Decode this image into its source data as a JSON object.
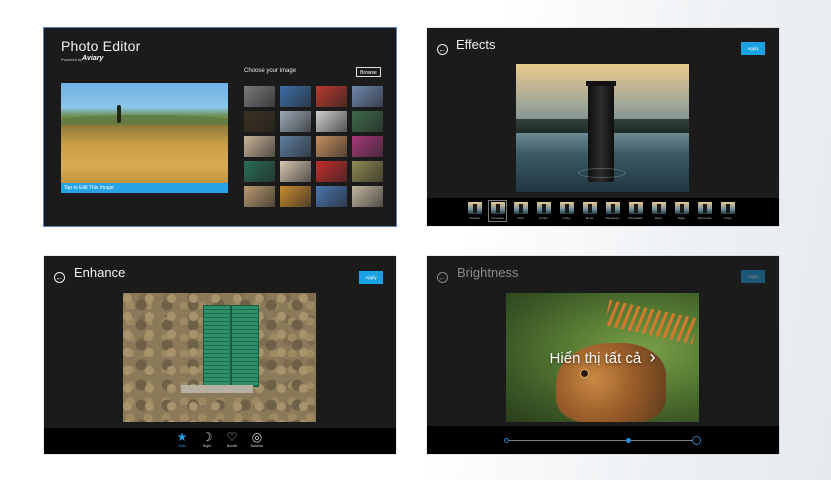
{
  "colors": {
    "accent": "#1aa1e4",
    "panel_bg": "#1b1b1b",
    "toolbar_bg": "#000000"
  },
  "photo_editor": {
    "title": "Photo Editor",
    "powered_by": "Powered by",
    "brand": "Aviary",
    "caption": "Tap to Edit This Image",
    "choose_label": "Choose your image",
    "browse_label": "Browse",
    "thumbnail_colors": [
      [
        "#7a7a7a",
        "#3e6fa8",
        "#b73a2e",
        "#6f88b0"
      ],
      [
        "#3a3020",
        "#9aa7b5",
        "#cfcfcf",
        "#3d6b4a"
      ],
      [
        "#c9b59a",
        "#5d7fa0",
        "#c79060",
        "#a63a78"
      ],
      [
        "#2a6d5a",
        "#d6c5b0",
        "#c42d2d",
        "#8e8a50"
      ],
      [
        "#b89a70",
        "#c78a30",
        "#4a76b0",
        "#c2b6a0"
      ]
    ]
  },
  "effects": {
    "title": "Effects",
    "apply_label": "Apply",
    "items": [
      "Lifestyle",
      "Nostalgia",
      "Vivid",
      "Amaro",
      "Lucky",
      "Mood",
      "Daydream",
      "Boardwalk",
      "Retro",
      "Sage",
      "Metropolis",
      "Cross"
    ]
  },
  "enhance": {
    "title": "Enhance",
    "apply_label": "Apply",
    "tools": [
      {
        "icon": "star-icon",
        "label": "Auto",
        "active": true
      },
      {
        "icon": "moon-icon",
        "label": "Night",
        "active": false
      },
      {
        "icon": "bulb-icon",
        "label": "Backlit",
        "active": false
      },
      {
        "icon": "balance-icon",
        "label": "Balance",
        "active": false
      }
    ]
  },
  "brightness": {
    "title": "Brightness",
    "apply_label": "Apply",
    "overlay_text": "Hiển thị tất cả",
    "overlay_icon": "chevron-right-icon",
    "slider_value": 0.5
  }
}
